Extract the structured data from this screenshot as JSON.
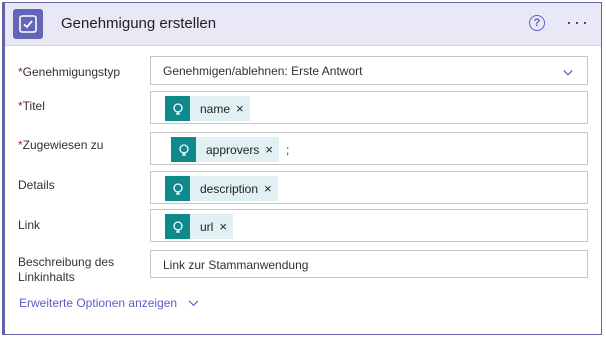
{
  "header": {
    "title": "Genehmigung erstellen",
    "help_glyph": "?",
    "more_glyph": "···",
    "accent": "#6264a7"
  },
  "fields": {
    "required_marker": "*",
    "approval_type": {
      "label": "Genehmigungstyp",
      "value": "Genehmigen/ablehnen: Erste Antwort"
    },
    "title": {
      "label": "Titel",
      "token": "name"
    },
    "assigned_to": {
      "label": "Zugewiesen zu",
      "token": "approvers",
      "suffix": ";"
    },
    "details": {
      "label": "Details",
      "token": "description"
    },
    "link": {
      "label": "Link",
      "token": "url"
    },
    "link_description": {
      "label_line1": "Beschreibung des",
      "label_line2": "Linkinhalts",
      "value": "Link zur Stammanwendung"
    }
  },
  "token_remove_glyph": "×",
  "advanced_options": "Erweiterte Optionen anzeigen",
  "colors": {
    "token_bg": "#e1f1f3",
    "token_icon_bg": "#0e8a8c",
    "link": "#5b5fc7",
    "required": "#a4262c"
  }
}
